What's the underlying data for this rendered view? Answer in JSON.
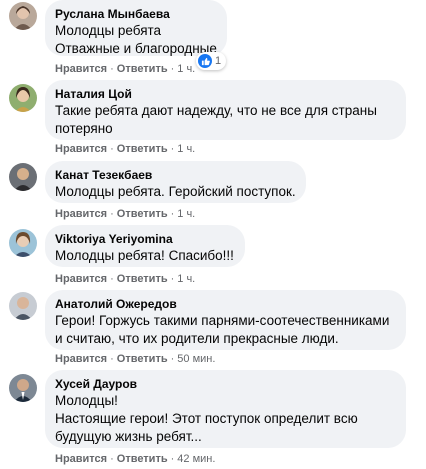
{
  "actions": {
    "like": "Нравится",
    "reply": "Ответить",
    "separator": "·"
  },
  "comments": [
    {
      "author": "Руслана Мынбаева",
      "lines": [
        "Молодцы ребята",
        "Отважные и благородные"
      ],
      "time": "1 ч.",
      "reactions": {
        "icon": "like-icon",
        "count": "1"
      }
    },
    {
      "author": "Наталия Цой",
      "lines": [
        "Такие ребята дают надежду, что не все для страны",
        "потеряно"
      ],
      "time": "1 ч."
    },
    {
      "author": "Канат Тезекбаев",
      "lines": [
        "Молодцы ребята. Геройский поступок."
      ],
      "time": "1 ч."
    },
    {
      "author": "Viktoriya Yeriyomina",
      "lines": [
        "Молодцы ребята! Спасибо!!!"
      ],
      "time": "1 ч."
    },
    {
      "author": "Анатолий Ожередов",
      "lines": [
        "Герои! Горжусь такими парнями-соотечественниками",
        "и считаю, что их родители прекрасные люди."
      ],
      "time": "50 мин."
    },
    {
      "author": "Хусей Дауров",
      "lines": [
        "Молодцы!",
        "Настоящие герои! Этот поступок определит всю",
        "будущую жизнь ребят..."
      ],
      "time": "42 мин."
    }
  ],
  "colors": {
    "bubble": "#f0f2f5",
    "meta_text": "#65676b",
    "like_blue": "#1877f2"
  }
}
